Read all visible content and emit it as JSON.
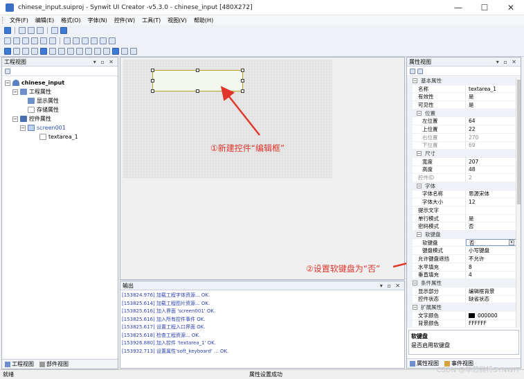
{
  "window": {
    "title": "chinese_input.suiproj - Synwit UI Creator -v5.3.0 - chinese_input [480X272]",
    "minimize_glyph": "—",
    "maximize_glyph": "☐",
    "close_glyph": "✕"
  },
  "menu": [
    "文件(F)",
    "编辑(E)",
    "格式(O)",
    "字体(N)",
    "控件(W)",
    "工具(T)",
    "视图(V)",
    "帮助(H)"
  ],
  "project_panel": {
    "title": "工程视图",
    "controls": "▾ ▫ ✕",
    "tree": [
      {
        "label": "chinese_input",
        "bold": true
      },
      {
        "label": "工程属性"
      },
      {
        "label": "显示属性"
      },
      {
        "label": "存储属性"
      },
      {
        "label": "控件属性"
      },
      {
        "label": "screen001"
      },
      {
        "label": "textarea_1"
      }
    ],
    "tabs": [
      "工程视图",
      "部件视图"
    ]
  },
  "canvas": {
    "annotation_1": "①新建控件“编辑框”",
    "annotation_2": "②设置软键盘为“否”"
  },
  "output_panel": {
    "title": "输出",
    "controls": "▾ ▫ ✕",
    "lines": [
      "[153824.976] 加载工程字体资源... OK.",
      "[153825.614] 加载工程图片资源... OK.",
      "[153825.616] 加入界面 'screen001' OK.",
      "[153825.616] 加入所有控件事件 OK.",
      "[153825.617] 设置工程入口界面 OK.",
      "[153825.618] 检查工程资源... OK.",
      "[153926.880] 加入控件 'textarea_1' OK.",
      "[153932.713] 设置属性'soft_keyboard' ... OK."
    ]
  },
  "props_panel": {
    "title": "属性视图",
    "controls": "▾ ▫ ✕",
    "rows": [
      {
        "type": "cat",
        "name": "基本属性"
      },
      {
        "type": "prop",
        "name": "名称",
        "value": "textarea_1"
      },
      {
        "type": "prop",
        "name": "有效性",
        "value": "是"
      },
      {
        "type": "prop",
        "name": "可见性",
        "value": "是"
      },
      {
        "type": "subcat",
        "name": "位置"
      },
      {
        "type": "sub",
        "name": "左位置",
        "value": "64"
      },
      {
        "type": "sub",
        "name": "上位置",
        "value": "22"
      },
      {
        "type": "sub",
        "name": "右位置",
        "value": "270",
        "gray": true
      },
      {
        "type": "sub",
        "name": "下位置",
        "value": "69",
        "gray": true
      },
      {
        "type": "subcat",
        "name": "尺寸"
      },
      {
        "type": "sub",
        "name": "宽度",
        "value": "207"
      },
      {
        "type": "sub",
        "name": "高度",
        "value": "48"
      },
      {
        "type": "prop",
        "name": "控件ID",
        "value": "2",
        "gray": true
      },
      {
        "type": "subcat",
        "name": "字体"
      },
      {
        "type": "sub",
        "name": "字体名称",
        "value": "思源宋体"
      },
      {
        "type": "sub",
        "name": "字体大小",
        "value": "12"
      },
      {
        "type": "prop",
        "name": "提示文字",
        "value": ""
      },
      {
        "type": "prop",
        "name": "单行模式",
        "value": "是"
      },
      {
        "type": "prop",
        "name": "密码模式",
        "value": "否"
      },
      {
        "type": "subcat",
        "name": "软键盘"
      },
      {
        "type": "sub",
        "name": "软键盘",
        "value": "否",
        "selected": true
      },
      {
        "type": "sub",
        "name": "键盘模式",
        "value": "小写键盘"
      },
      {
        "type": "prop",
        "name": "允许键盘遮挡",
        "value": "不允许"
      },
      {
        "type": "prop",
        "name": "水平填充",
        "value": "8"
      },
      {
        "type": "prop",
        "name": "垂直填充",
        "value": "4"
      },
      {
        "type": "cat",
        "name": "条件属性"
      },
      {
        "type": "prop",
        "name": "显示部分",
        "value": "编辑框背景"
      },
      {
        "type": "prop",
        "name": "控件状态",
        "value": "缺省状态"
      },
      {
        "type": "cat",
        "name": "扩展属性"
      },
      {
        "type": "prop",
        "name": "文字颜色",
        "value": "000000",
        "swatch": "#000000"
      },
      {
        "type": "prop",
        "name": "背景颜色",
        "value": "FFFFFF"
      }
    ],
    "description_title": "软键盘",
    "description_text": "是否启用软键盘",
    "tabs": [
      "属性视图",
      "事件视图"
    ]
  },
  "status": {
    "left": "就绪",
    "center": "属性设置成功"
  },
  "watermark": "CSDN @华芯微特SYNWIT",
  "colors": {
    "annotation": "#e0352b",
    "widget_border": "#b8a020",
    "log_text": "#2a3fb0"
  }
}
